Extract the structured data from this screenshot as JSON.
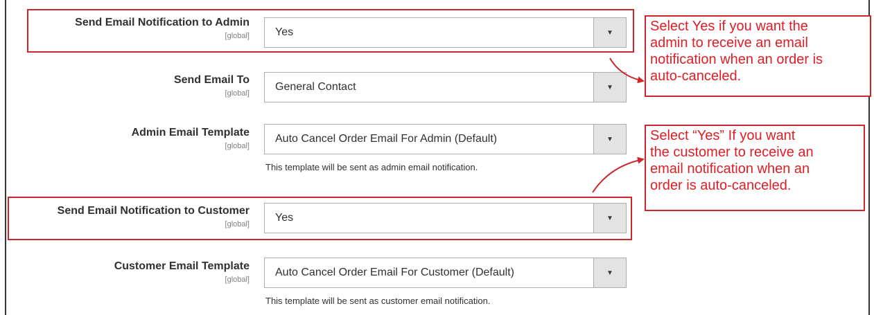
{
  "fields": [
    {
      "label": "Send Email Notification to Admin",
      "scope": "[global]",
      "value": "Yes",
      "note": ""
    },
    {
      "label": "Send Email To",
      "scope": "[global]",
      "value": "General Contact",
      "note": ""
    },
    {
      "label": "Admin Email Template",
      "scope": "[global]",
      "value": "Auto Cancel Order Email For Admin (Default)",
      "note": "This template will be sent as admin email notification."
    },
    {
      "label": "Send Email Notification to Customer",
      "scope": "[global]",
      "value": "Yes",
      "note": ""
    },
    {
      "label": "Customer Email Template",
      "scope": "[global]",
      "value": "Auto Cancel Order Email For Customer (Default)",
      "note": "This template will be sent as customer email notification."
    }
  ],
  "callouts": {
    "admin": {
      "line1": "Select Yes if you want the",
      "line2": "admin to receive an email",
      "line3": "notification when an order is",
      "line4": "auto-canceled."
    },
    "customer": {
      "line1": "Select “Yes” If you want",
      "line2": "the customer to receive an",
      "line3": "email notification when an",
      "line4": "order is auto-canceled."
    }
  },
  "icons": {
    "dropdown": "triangle-down-icon",
    "annotation": "arrow-icon"
  },
  "colors": {
    "annotation_red": "#d0252b",
    "callout_text": "#e01d25"
  }
}
